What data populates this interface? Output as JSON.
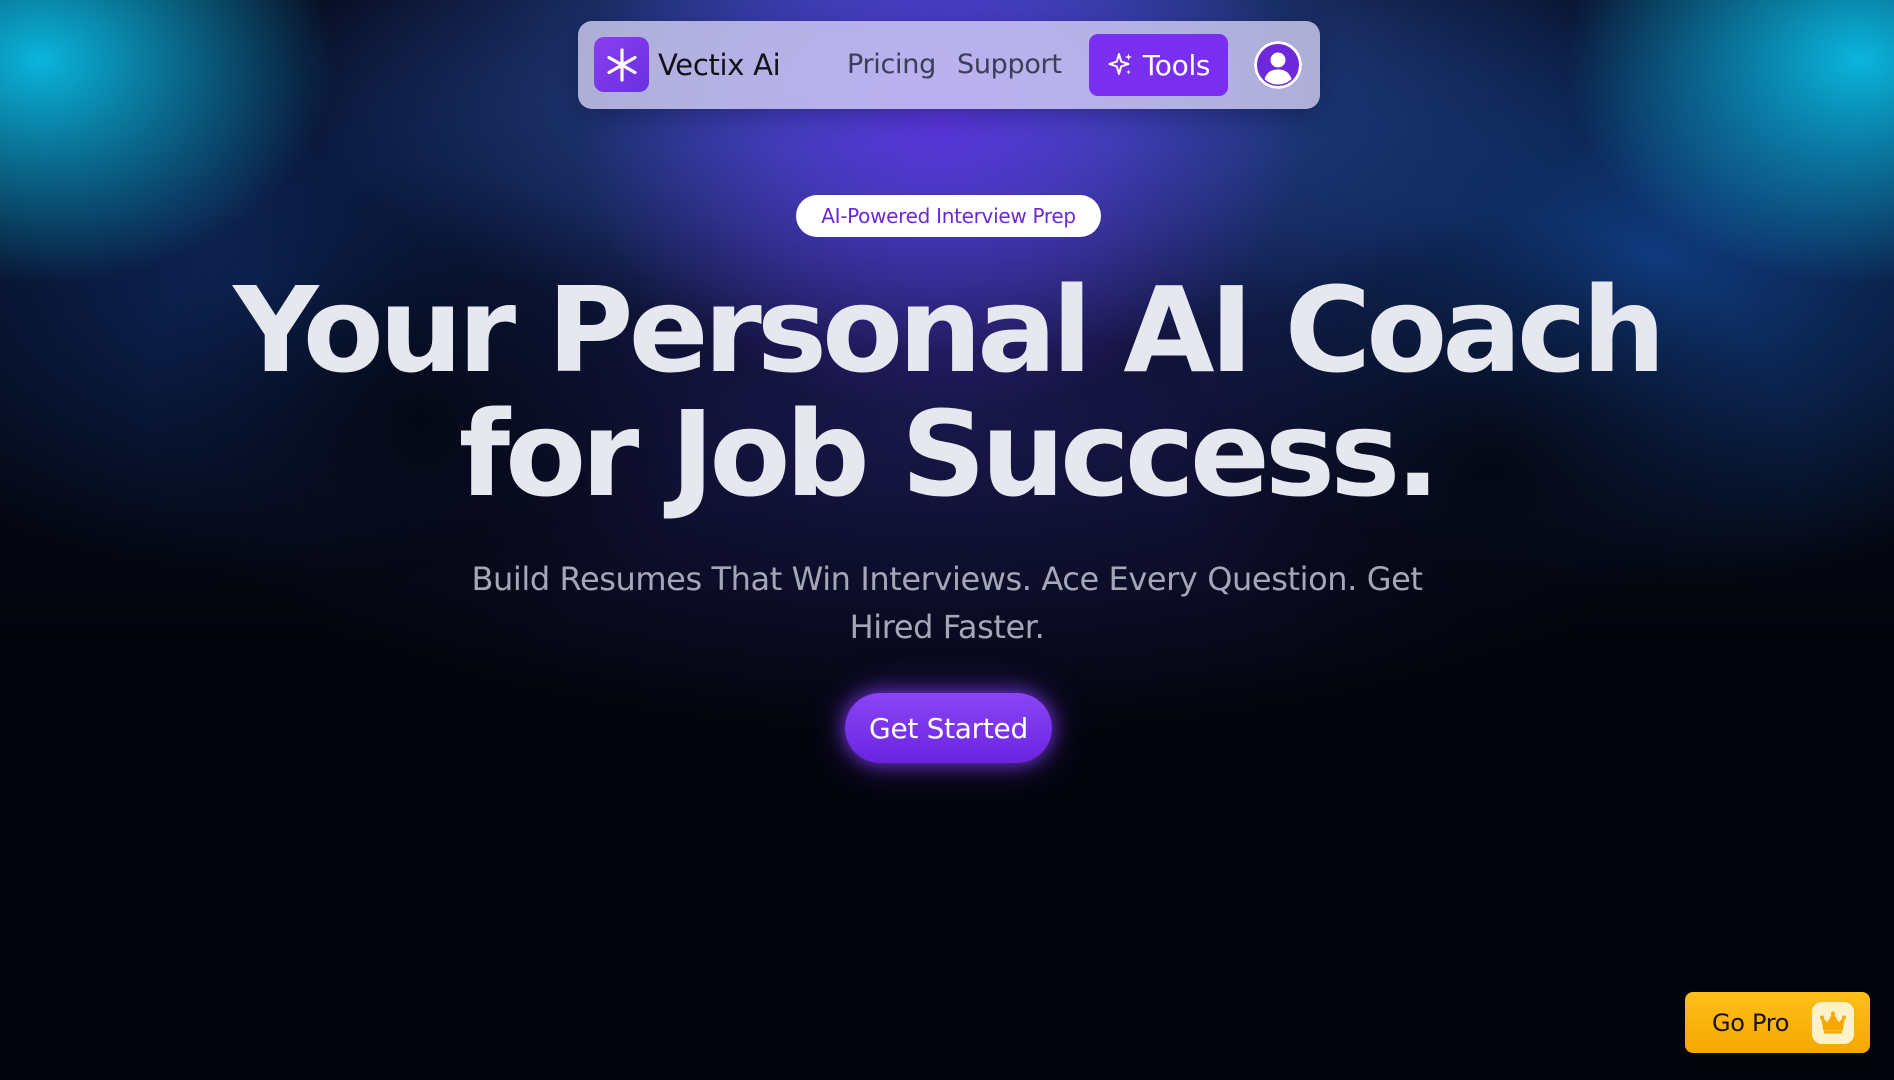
{
  "nav": {
    "brand_name": "Vectix Ai",
    "links": [
      {
        "label": "Pricing"
      },
      {
        "label": "Support"
      }
    ],
    "tools_label": "Tools"
  },
  "hero": {
    "badge": "AI-Powered Interview Prep",
    "headline_line1": "Your Personal AI Coach",
    "headline_line2": "for Job Success.",
    "subtitle": "Build Resumes That Win Interviews. Ace Every Question. Get Hired Faster.",
    "cta_label": "Get Started"
  },
  "gopro": {
    "label": "Go Pro"
  },
  "colors": {
    "accent": "#7a2ff0",
    "gopro": "#ffb80d",
    "background": "#03050d",
    "headline": "#e6e8f0"
  },
  "icons": {
    "brand_logo": "asterisk-icon",
    "tools": "sparkle-icon",
    "avatar": "user-avatar-icon",
    "gopro": "crown-icon"
  }
}
